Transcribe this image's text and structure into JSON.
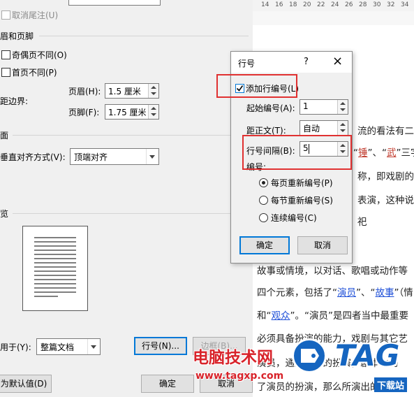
{
  "page_setup": {
    "suppress_endnotes": "取消尾注(U)",
    "headers_footers_section": "眉和页脚",
    "different_odd_even": "奇偶页不同(O)",
    "different_first_page": "首页不同(P)",
    "from_edge_label": "距边界:",
    "header_label": "页眉(H):",
    "header_value": "1.5 厘米",
    "footer_label": "页脚(F):",
    "footer_value": "1.75 厘米",
    "page_section": "面",
    "vertical_align_label": "垂直对齐方式(V):",
    "vertical_align_value": "顶端对齐",
    "preview_section": "览",
    "apply_to_label": "用于(Y):",
    "apply_to_value": "整篇文档",
    "line_numbers_button": "行号(N)...",
    "borders_button": "边框(B)...",
    "set_default_button": "为默认值(D)",
    "ok_button": "确定",
    "cancel_button": "取消"
  },
  "ruler": {
    "marks": [
      "14",
      "16",
      "18",
      "20",
      "22",
      "24",
      "26",
      "28",
      "30",
      "32",
      "34",
      "36"
    ]
  },
  "document": {
    "l1a": "流的看法有二",
    "l2a": "“",
    "l2b": "锤",
    "l2c": "”、“",
    "l2d": "武",
    "l2e": "”三字",
    "l3": "称，即戏剧的",
    "l4": "表演，这种说法",
    "l5": "祀",
    "l6": "故事或情境，以对话、歌唱或动作等",
    "l7a": "四个元素，包括了“",
    "l7b": "演员",
    "l7c": "”、“",
    "l7d": "故事",
    "l7e": "”（情",
    "l8a": "和“",
    "l8b": "观众",
    "l8c": "”。“演员”是四者当中最重要",
    "l9": "必须具备扮演的能力，戏剧与其它艺",
    "l10": "演员，通过演员的扮演，剧本中的",
    "l11": "了演员的扮演，那么所演出的便不"
  },
  "line_numbers_dialog": {
    "title": "行号",
    "help": "?",
    "close": "×",
    "add_line_numbering": "添加行编号(L)",
    "start_at_label": "起始编号(A):",
    "start_at_value": "1",
    "from_text_label": "距正文(T):",
    "from_text_value": "自动",
    "count_by_label": "行号间隔(B):",
    "count_by_value": "5",
    "numbering_label": "编号:",
    "restart_each_page": "每页重新编号(P)",
    "restart_each_section": "每节重新编号(S)",
    "continuous": "连续编号(C)",
    "ok_button": "确定",
    "cancel_button": "取消"
  },
  "watermark": {
    "site_name": "电脑技术网",
    "url": "www.tagxp.com",
    "logo_text": "TAG",
    "download_text": "下载站"
  },
  "colors": {
    "highlight": "#e03131",
    "link": "#1e4fd8",
    "focus": "#0078d7",
    "logo_blue": "#1565c0"
  }
}
